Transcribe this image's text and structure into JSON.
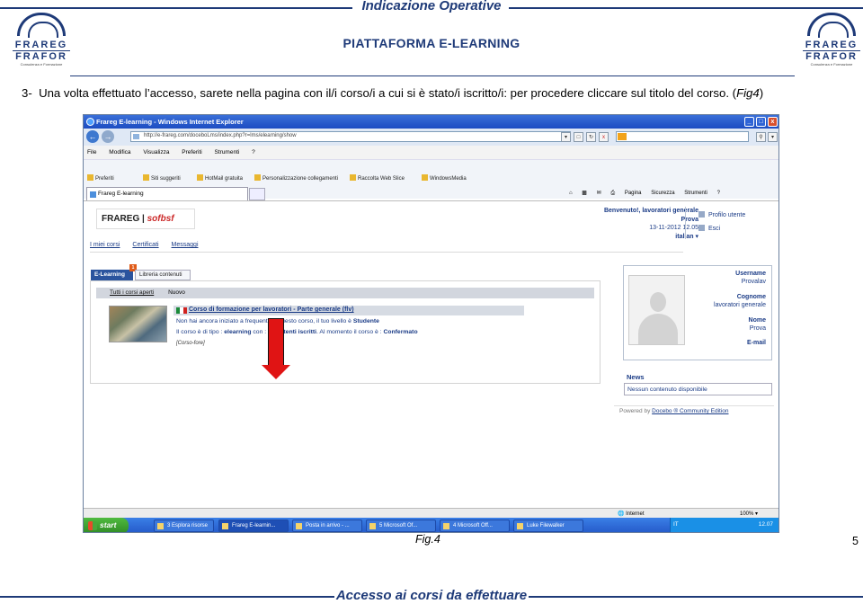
{
  "header": {
    "title": "Indicazione Operative",
    "subtitle": "PIATTAFORMA E-LEARNING",
    "logo": {
      "line1": "FRAREG",
      "line2": "FRAFOR",
      "tagline": "Consulenza e Formazione"
    }
  },
  "step": {
    "number": "3-",
    "text": "Una volta effettuato l’accesso, sarete nella pagina con il/i corso/i a cui si è stato/i iscritto/i: per procedere cliccare sul titolo del corso. (",
    "fig_ref": "Fig4",
    "close": ")"
  },
  "browser": {
    "window_title": "Frareg E-learning - Windows Internet Explorer",
    "address": "http://e-frareg.com/doceboLms/index.php?r=lms/elearning/show",
    "menu": [
      "File",
      "Modifica",
      "Visualizza",
      "Preferiti",
      "Strumenti",
      "?"
    ],
    "favorites": [
      "Preferiti",
      "Siti suggeriti",
      "HotMail gratuita",
      "Personalizzazione collegamenti",
      "Raccolta Web Slice",
      "WindowsMedia"
    ],
    "tab": "Frareg E-learning",
    "commands": [
      "Pagina",
      "Sicurezza",
      "Strumenti"
    ],
    "status_zone": "Internet",
    "zoom": "100%"
  },
  "page": {
    "brand": "FRAREG",
    "brand_sig": "sofbsf",
    "welcome": "Benvenuto!, lavoratori generale",
    "welcome_name": "Prova",
    "datetime": "13-11-2012 12.05",
    "language": "italian",
    "links": [
      "Profilo utente",
      "Esci"
    ],
    "top_nav": [
      "I miei corsi",
      "Certificati",
      "Messaggi"
    ],
    "tab_elearning": "E-Learning",
    "tab_count": "1",
    "tab_library": "Libreria contenuti",
    "filter_all": "Tutti i corsi aperti",
    "filter_new": "Nuovo",
    "course": {
      "title": "Corso di formazione per lavoratori - Parte generale (flv)",
      "line1_pre": "Non hai ancora iniziato a frequentare questo corso, il tuo livello è ",
      "line1_bold": "Studente",
      "line2_pre": "Il corso è di tipo : ",
      "line2_type": "elearning",
      "line2_mid": " con : ",
      "line2_users": "710 utenti iscritti",
      "line2_post": ". Al momento il corso è : ",
      "line2_state": "Confermato",
      "tag": "[Corso-fore]"
    },
    "profile": {
      "username_label": "Username",
      "username": "Provalav",
      "cognome_label": "Cognome",
      "cognome": "lavoratori generale",
      "nome_label": "Nome",
      "nome": "Prova",
      "email_label": "E-mail"
    },
    "news_label": "News",
    "news_text": "Nessun contenuto disponibile",
    "powered_pre": "Powered by ",
    "powered_link": "Docebo ® Community Edition"
  },
  "taskbar": {
    "start": "start",
    "tasks": [
      "3 Esplora risorse",
      "Frareg E-learnin...",
      "Posta in arrivo - ...",
      "5 Microsoft Of...",
      "4 Microsoft Off...",
      "Luke Filewalker"
    ],
    "lang": "IT",
    "clock": "12.07"
  },
  "caption": "Fig.4",
  "page_number": "5",
  "footer": "Accesso ai corsi da effettuare"
}
